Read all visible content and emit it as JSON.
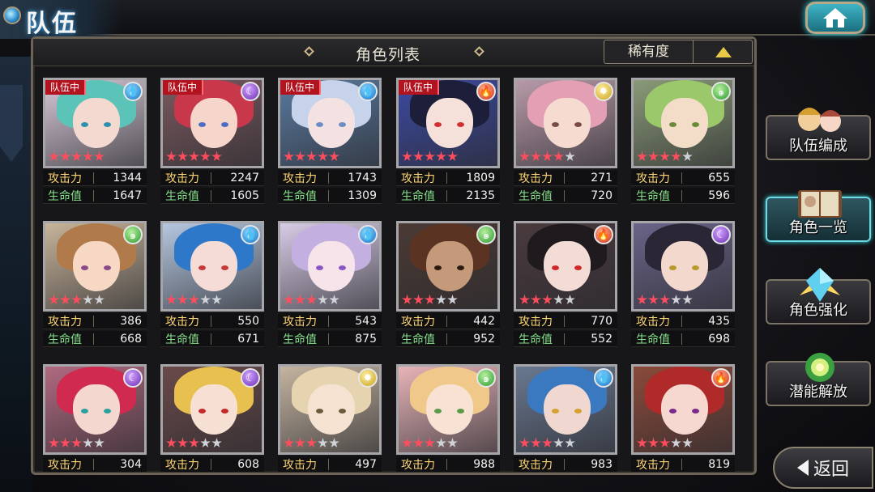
{
  "header": {
    "title": "队伍"
  },
  "panel": {
    "title": "角色列表",
    "sort_label": "稀有度"
  },
  "labels": {
    "attack": "攻击力",
    "hp": "生命值"
  },
  "side_menu": [
    {
      "label": "队伍编成",
      "icon": "party-portraits-icon"
    },
    {
      "label": "角色一览",
      "icon": "book-icon",
      "active": true
    },
    {
      "label": "角色强化",
      "icon": "power-up-crystal-icon"
    },
    {
      "label": "潜能解放",
      "icon": "potential-orb-icon"
    }
  ],
  "back_label": "返回",
  "cards": [
    {
      "badge": "队伍中",
      "element": "water",
      "stars": 5,
      "atk": "1344",
      "hp": "1647",
      "hair": "#5bc3b8",
      "skin": "#f3d9cf",
      "bg": "#d8c9d8",
      "eye": "#2f8fb0"
    },
    {
      "badge": "队伍中",
      "element": "moon",
      "stars": 5,
      "atk": "2247",
      "hp": "1605",
      "hair": "#c8384a",
      "skin": "#f6d6cb",
      "bg": "#7a5a60",
      "eye": "#4a6cc4"
    },
    {
      "badge": "队伍中",
      "element": "water",
      "stars": 5,
      "atk": "1743",
      "hp": "1309",
      "hair": "#c6d3ea",
      "skin": "#f4e2e2",
      "bg": "#5a7aa0",
      "eye": "#6c8cc4"
    },
    {
      "badge": "队伍中",
      "element": "fire",
      "stars": 5,
      "atk": "1809",
      "hp": "2135",
      "hair": "#1c1e3a",
      "skin": "#f6e0da",
      "bg": "#3c4aa0",
      "eye": "#d03030"
    },
    {
      "badge": "",
      "element": "light",
      "stars": 4,
      "atk": "271",
      "hp": "720",
      "hair": "#e3a0b4",
      "skin": "#f6dcd0",
      "bg": "#b89aa8",
      "eye": "#7a4a4a"
    },
    {
      "badge": "",
      "element": "wind",
      "stars": 4,
      "atk": "655",
      "hp": "596",
      "hair": "#9bc86a",
      "skin": "#f3ddc8",
      "bg": "#8a9a78",
      "eye": "#6a8a38"
    },
    {
      "badge": "",
      "element": "wind",
      "stars": 3,
      "atk": "386",
      "hp": "668",
      "hair": "#b07a4a",
      "skin": "#f6d8c4",
      "bg": "#c7b49a",
      "eye": "#8a4a8a"
    },
    {
      "badge": "",
      "element": "water",
      "stars": 3,
      "atk": "550",
      "hp": "671",
      "hair": "#2d78c8",
      "skin": "#f6dcd6",
      "bg": "#b5c7e0",
      "eye": "#c43a3a"
    },
    {
      "badge": "",
      "element": "water",
      "stars": 3,
      "atk": "543",
      "hp": "875",
      "hair": "#c4b0e0",
      "skin": "#f6e4ea",
      "bg": "#d8cce6",
      "eye": "#8a58c4"
    },
    {
      "badge": "",
      "element": "wind",
      "stars": 3,
      "atk": "442",
      "hp": "952",
      "hair": "#5a3322",
      "skin": "#c49a7a",
      "bg": "#4a3a34",
      "eye": "#2a1a10"
    },
    {
      "badge": "",
      "element": "fire",
      "stars": 3,
      "atk": "770",
      "hp": "552",
      "hair": "#1e1a1e",
      "skin": "#f4dcd6",
      "bg": "#4a3a3e",
      "eye": "#d02828"
    },
    {
      "badge": "",
      "element": "moon",
      "stars": 3,
      "atk": "435",
      "hp": "698",
      "hair": "#2a2636",
      "skin": "#f3d8ce",
      "bg": "#6a6488",
      "eye": "#b89a2a"
    },
    {
      "badge": "",
      "element": "moon",
      "stars": 3,
      "atk": "304",
      "hp": "",
      "hair": "#d02a50",
      "skin": "#f4d8d0",
      "bg": "#b06a80",
      "eye": "#2aa0a0"
    },
    {
      "badge": "",
      "element": "moon",
      "stars": 3,
      "atk": "608",
      "hp": "",
      "hair": "#e8c050",
      "skin": "#f6e0d4",
      "bg": "#6a4a4a",
      "eye": "#c42828"
    },
    {
      "badge": "",
      "element": "light",
      "stars": 3,
      "atk": "497",
      "hp": "",
      "hair": "#e6d4b0",
      "skin": "#f6e2d0",
      "bg": "#c4b4a0",
      "eye": "#6a5a3a"
    },
    {
      "badge": "",
      "element": "wind",
      "stars": 3,
      "atk": "988",
      "hp": "",
      "hair": "#f0c88a",
      "skin": "#f8e2d4",
      "bg": "#e6b4b8",
      "eye": "#5a9a4a"
    },
    {
      "badge": "",
      "element": "water",
      "stars": 3,
      "atk": "983",
      "hp": "",
      "hair": "#3a78c0",
      "skin": "#f0d8d0",
      "bg": "#6a7890",
      "eye": "#d4a030"
    },
    {
      "badge": "",
      "element": "fire",
      "stars": 3,
      "atk": "819",
      "hp": "",
      "hair": "#b02a2a",
      "skin": "#f6d8d0",
      "bg": "#8a4a3a",
      "eye": "#7a2a8a"
    }
  ]
}
